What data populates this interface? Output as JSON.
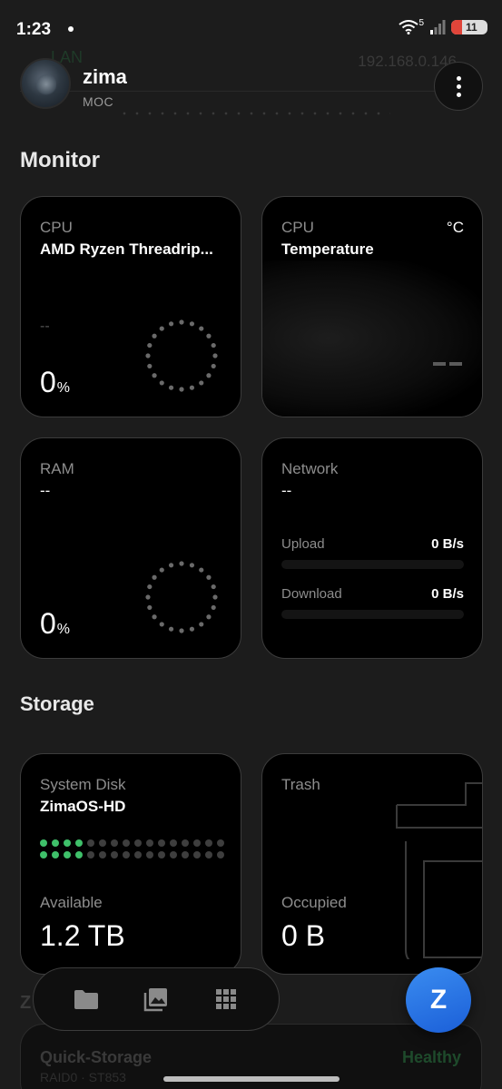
{
  "status_bar": {
    "time": "1:23",
    "battery": "11",
    "wifi_badge": "5"
  },
  "header": {
    "ghost_label": "LAN",
    "ghost_ip": "192.168.0.146",
    "name": "zima",
    "subtitle": "MOC"
  },
  "sections": {
    "monitor": "Monitor",
    "storage": "Storage",
    "next_initial": "Z"
  },
  "cpu": {
    "label": "CPU",
    "model": "AMD Ryzen Threadrip...",
    "secondary": "--",
    "usage_value": "0",
    "unit": "%"
  },
  "temperature": {
    "label": "CPU",
    "title": "Temperature",
    "unit": "°C"
  },
  "ram": {
    "label": "RAM",
    "value": "--",
    "usage_value": "0",
    "unit": "%"
  },
  "network": {
    "label": "Network",
    "value": "--",
    "upload_label": "Upload",
    "upload_value": "0 B/s",
    "download_label": "Download",
    "download_value": "0 B/s"
  },
  "system_disk": {
    "label": "System Disk",
    "name": "ZimaOS-HD",
    "available_label": "Available",
    "available_value": "1.2 TB",
    "used_fraction": 0.22
  },
  "trash": {
    "label": "Trash",
    "occupied_label": "Occupied",
    "occupied_value": "0 B"
  },
  "next_card": {
    "title": "Quick-Storage",
    "subtitle": "RAID0 · ST853",
    "status": "Healthy"
  },
  "nav": {
    "items": [
      "folder-icon",
      "photos-icon",
      "apps-grid-icon"
    ],
    "fab_label": "Z"
  },
  "colors": {
    "accent_green": "#3fc06a",
    "fab_blue": "#2a74e6"
  }
}
